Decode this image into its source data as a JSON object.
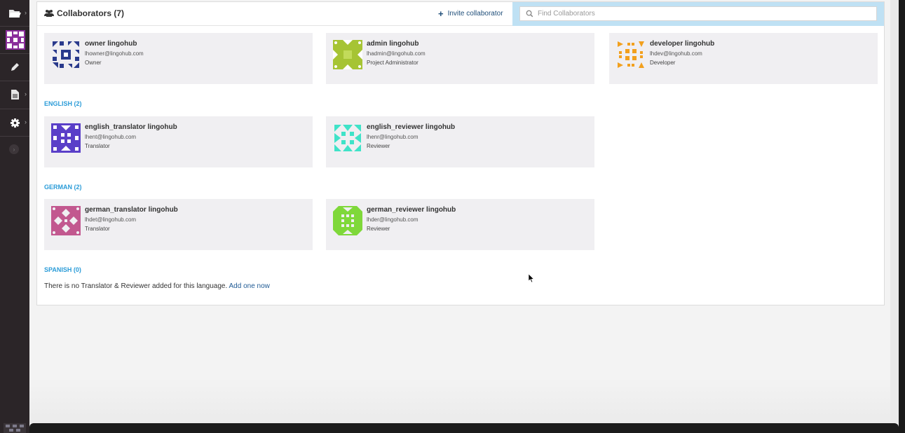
{
  "header": {
    "title": "Collaborators (7)",
    "invite_label": "Invite collaborator",
    "search_placeholder": "Find Collaborators"
  },
  "cards": [
    {
      "name": "owner lingohub",
      "email": "lhowner@lingohub.com",
      "role": "Owner",
      "color": "#2a3a8c"
    },
    {
      "name": "admin lingohub",
      "email": "lhadmin@lingohub.com",
      "role": "Project Administrator",
      "color": "#a6c434"
    },
    {
      "name": "developer lingohub",
      "email": "lhdev@lingohub.com",
      "role": "Developer",
      "color": "#f2a01e"
    }
  ],
  "sections": [
    {
      "title": "ENGLISH (2)",
      "cards": [
        {
          "name": "english_translator lingohub",
          "email": "lhent@lingohub.com",
          "role": "Translator",
          "color": "#5a3fc8"
        },
        {
          "name": "english_reviewer lingohub",
          "email": "lhenr@lingohub.com",
          "role": "Reviewer",
          "color": "#3fe3c8"
        }
      ]
    },
    {
      "title": "GERMAN (2)",
      "cards": [
        {
          "name": "german_translator lingohub",
          "email": "lhdet@lingohub.com",
          "role": "Translator",
          "color": "#c2588f"
        },
        {
          "name": "german_reviewer lingohub",
          "email": "lhder@lingohub.com",
          "role": "Reviewer",
          "color": "#7fd83a"
        }
      ]
    },
    {
      "title": "SPANISH (0)",
      "empty_text": "There is no Translator & Reviewer added for this language.",
      "add_link": "Add one now"
    }
  ],
  "sidebar": {
    "icons": [
      "folder-icon",
      "project-avatar",
      "pencil-icon",
      "document-icon",
      "gear-icon"
    ],
    "accent": "#8a2d9b"
  }
}
